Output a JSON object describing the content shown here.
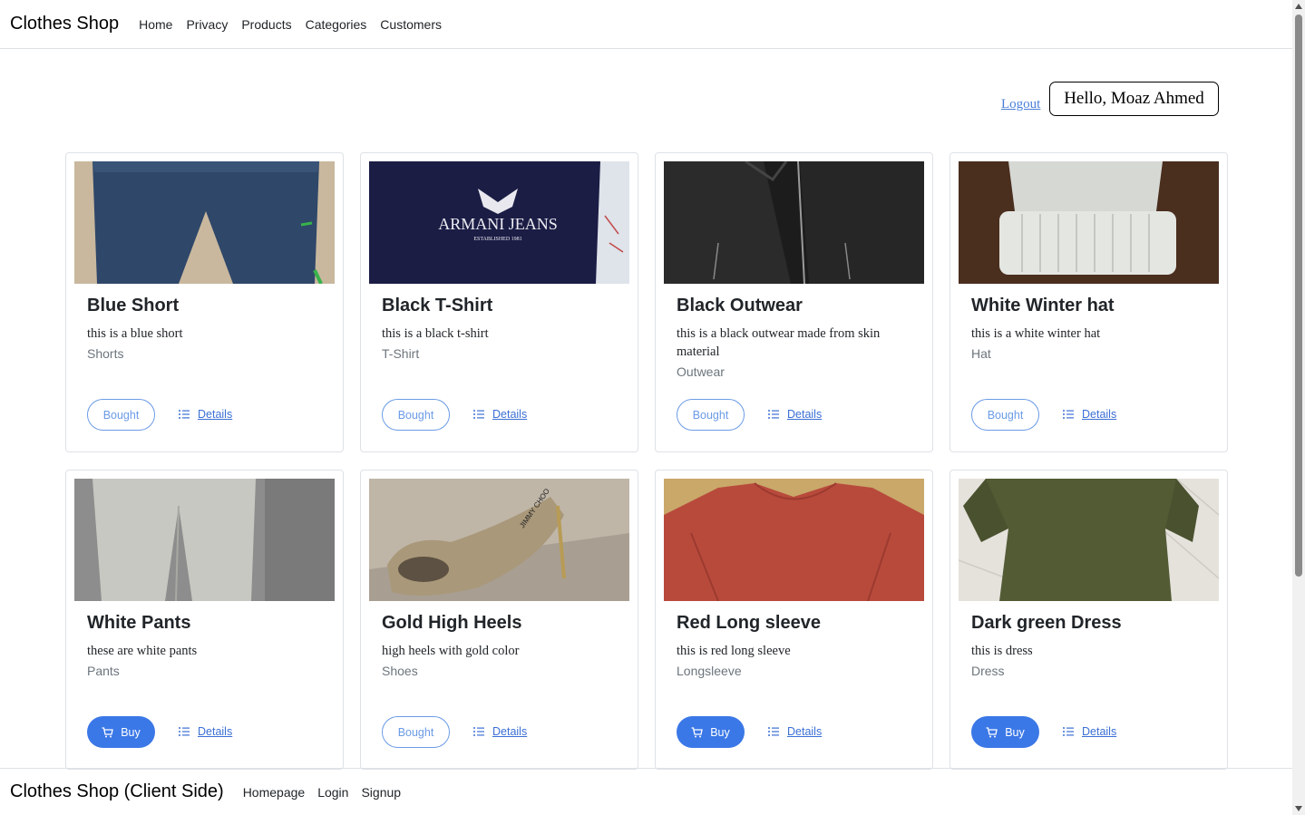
{
  "navbar": {
    "brand": "Clothes Shop",
    "links": [
      "Home",
      "Privacy",
      "Products",
      "Categories",
      "Customers"
    ]
  },
  "user": {
    "logout": "Logout",
    "greeting": "Hello, Moaz Ahmed"
  },
  "products": [
    {
      "title": "Blue Short",
      "description": "this is a blue short",
      "category": "Shorts",
      "button": "Bought",
      "status": "bought",
      "details": "Details",
      "image": "blue shorts"
    },
    {
      "title": "Black T-Shirt",
      "description": "this is a black t-shirt",
      "category": "T-Shirt",
      "button": "Bought",
      "status": "bought",
      "details": "Details",
      "image": "navy t-shirt with logo",
      "image_text": [
        "ARMANI JEANS",
        "ESTABLISHED 1981"
      ]
    },
    {
      "title": "Black Outwear",
      "description": "this is a black outwear made from skin material",
      "category": "Outwear",
      "button": "Bought",
      "status": "bought",
      "details": "Details",
      "image": "black leather jacket"
    },
    {
      "title": "White Winter hat",
      "description": "this is a white winter hat",
      "category": "Hat",
      "button": "Bought",
      "status": "bought",
      "details": "Details",
      "image": "white knit beanie"
    },
    {
      "title": "White Pants",
      "description": "these are white pants",
      "category": "Pants",
      "button": "Buy",
      "status": "buy",
      "details": "Details",
      "image": "white pants"
    },
    {
      "title": "Gold High Heels",
      "description": "high heels with gold color",
      "category": "Shoes",
      "button": "Bought",
      "status": "bought",
      "details": "Details",
      "image": "gold glitter high heels",
      "image_text": [
        "JIMMY CHOO"
      ]
    },
    {
      "title": "Red Long sleeve",
      "description": "this is red long sleeve",
      "category": "Longsleeve",
      "button": "Buy",
      "status": "buy",
      "details": "Details",
      "image": "red long sleeve shirt"
    },
    {
      "title": "Dark green Dress",
      "description": "this is dress",
      "category": "Dress",
      "button": "Buy",
      "status": "buy",
      "details": "Details",
      "image": "dark green dress"
    }
  ],
  "footer": {
    "brand": "Clothes Shop (Client Side)",
    "links": [
      "Homepage",
      "Login",
      "Signup"
    ]
  },
  "colors": {
    "primary": "#3b78e7",
    "outline": "#6b9be6",
    "link": "#3b6fd4",
    "muted": "#6c757d",
    "border": "#dee2e6"
  },
  "icons": {
    "buy": "cart-icon",
    "details": "list-icon"
  }
}
